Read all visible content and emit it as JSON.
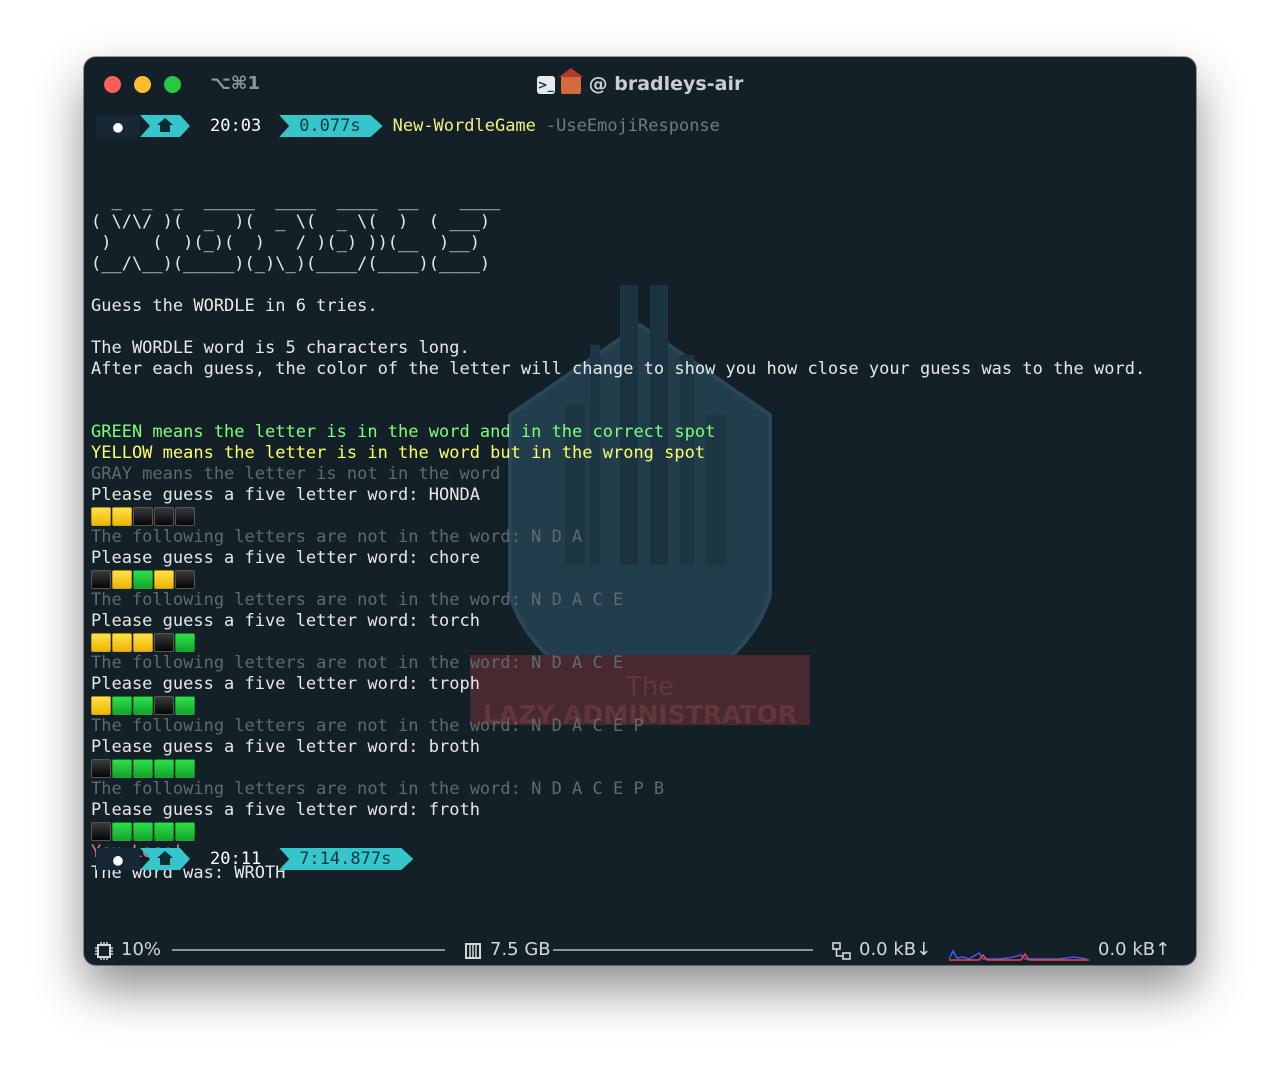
{
  "window": {
    "shortcut": "⌥⌘1",
    "title": "@ bradleys-air"
  },
  "prompt1": {
    "time": "20:03",
    "duration": "0.077s",
    "command": "New-WordleGame",
    "parameter": "-UseEmojiResponse"
  },
  "ascii_art": [
    "  _  _  _  _____  ____  ____  __    ____",
    "( \\/\\/ )(  _  )(  _ \\(  _ \\(  )  ( ___)",
    " )    (  )(_)(  )   / )(_) ))(__  )__)",
    "(__/\\__)(_____)(_)\\_)(____/(____)(____)"
  ],
  "intro": {
    "line1": "Guess the WORDLE in 6 tries.",
    "line2": "The WORDLE word is 5 characters long.",
    "line3": "After each guess, the color of the letter will change to show you how close your guess was to the word."
  },
  "legend": {
    "green": "GREEN means the letter is in the word and in the correct spot",
    "yellow": "YELLOW means the letter is in the word but in the wrong spot",
    "gray": "GRAY means the letter is not in the word"
  },
  "guesses": [
    {
      "prompt": "Please guess a five letter word: HONDA",
      "result": [
        "y",
        "y",
        "b",
        "b",
        "b"
      ],
      "excluded": "The following letters are not in the word: N D A"
    },
    {
      "prompt": "Please guess a five letter word: chore",
      "result": [
        "b",
        "y",
        "g",
        "y",
        "b"
      ],
      "excluded": "The following letters are not in the word: N D A C E"
    },
    {
      "prompt": "Please guess a five letter word: torch",
      "result": [
        "y",
        "y",
        "y",
        "b",
        "g"
      ],
      "excluded": "The following letters are not in the word: N D A C E"
    },
    {
      "prompt": "Please guess a five letter word: troph",
      "result": [
        "y",
        "g",
        "g",
        "b",
        "g"
      ],
      "excluded": "The following letters are not in the word: N D A C E P"
    },
    {
      "prompt": "Please guess a five letter word: broth",
      "result": [
        "b",
        "g",
        "g",
        "g",
        "g"
      ],
      "excluded": "The following letters are not in the word: N D A C E P B"
    },
    {
      "prompt": "Please guess a five letter word: froth",
      "result": [
        "b",
        "g",
        "g",
        "g",
        "g"
      ],
      "excluded": ""
    }
  ],
  "outcome": {
    "lose": "You Lose!",
    "answer": "The word was: WROTH"
  },
  "prompt2": {
    "time": "20:11",
    "duration": "7:14.877s"
  },
  "watermark": {
    "line1": "The",
    "line2": "LAZY ADMINISTRATOR"
  },
  "statusbar": {
    "cpu": "10%",
    "memory": "7.5 GB",
    "net_down": "0.0 kB↓",
    "net_up": "0.0 kB↑"
  },
  "colors": {
    "background": "#132028",
    "prompt_accent": "#35c6cb",
    "green_text": "#7dff77",
    "yellow_text": "#fbff6c",
    "gray_text": "#606a6e",
    "red_text": "#ff6f7d"
  }
}
